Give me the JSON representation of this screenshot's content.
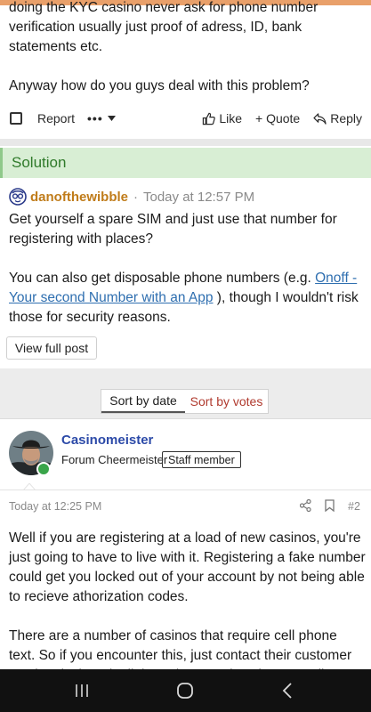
{
  "previous_post": {
    "line_cut": "doing the KYC casino never ask for phone number",
    "line_2": "verification usually just proof of adress, ID, bank",
    "line_3": "statements etc.",
    "line_4": "Anyway how do you guys deal with this problem?"
  },
  "post_actions": {
    "report": "Report",
    "more": "•••",
    "like": "Like",
    "quote": "+ Quote",
    "reply": "Reply"
  },
  "solution": {
    "header": "Solution",
    "username": "danofthewibble",
    "separator": "·",
    "time": "Today at 12:57 PM",
    "p1": "Get yourself a spare SIM and just use that number for registering with places?",
    "p2_pre": "You can also get disposable phone numbers (e.g. ",
    "p2_link": "Onoff - Your second Number with an App",
    "p2_post": " ), though I wouldn't risk those for security reasons.",
    "view_button": "View full post"
  },
  "sort": {
    "by_date": "Sort by date",
    "by_votes": "Sort by votes"
  },
  "post2": {
    "username": "Casinomeister",
    "user_title": "Forum Cheermeister",
    "badge": "Staff member",
    "time": "Today at 12:25 PM",
    "number": "#2",
    "p1": "Well if you are registering at a load of new casinos, you're just going to have to live with it. Registering a fake number could get you locked out of your account by not being able to recieve athorization codes.",
    "p2": "There are a number of casinos that require cell phone text. So if you encounter this, just contact their customer service desk and tell them that you don't have a cell phone, and"
  },
  "icons": {
    "checkbox": "checkbox-icon",
    "chevron": "chevron-down-icon",
    "like": "thumbs-up-icon",
    "reply": "reply-arrow-icon",
    "avatar_small": "glasses-face-icon",
    "share": "share-icon",
    "bookmark": "bookmark-icon",
    "nav_recent": "recent-apps-icon",
    "nav_home": "home-icon",
    "nav_back": "back-icon"
  },
  "colors": {
    "accent_top": "#e9a06a",
    "solution_bg": "#d8eed4",
    "solution_text": "#2f7a2a",
    "username_orange": "#c07c1a",
    "username_blue": "#2c4aa8",
    "link": "#2f6fb0",
    "sort_votes": "#b03a2e",
    "online": "#3aa54a"
  }
}
